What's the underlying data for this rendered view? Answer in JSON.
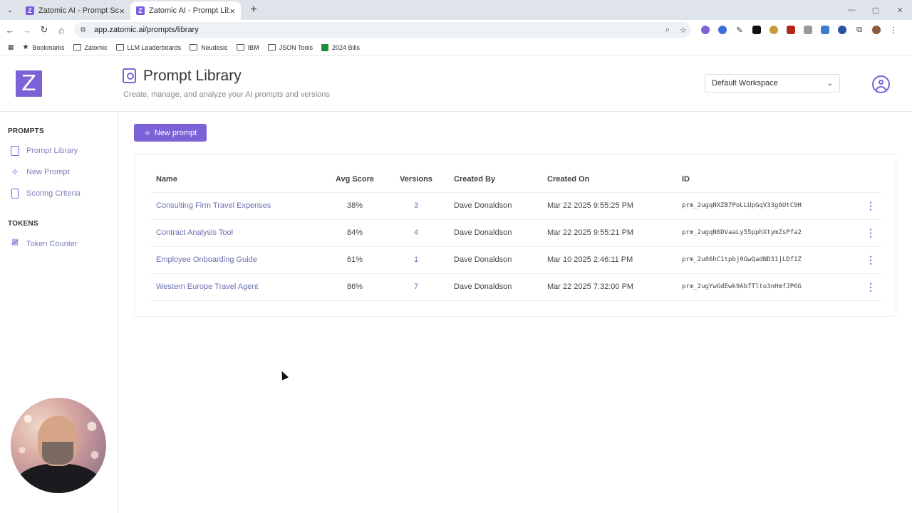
{
  "browser": {
    "tabs": [
      {
        "title": "Zatomic AI - Prompt Scoring",
        "active": false
      },
      {
        "title": "Zatomic AI - Prompt Library",
        "active": true
      }
    ],
    "url": "app.zatomic.ai/prompts/library",
    "bookmarks": [
      "Bookmarks",
      "Zatomic",
      "LLM Leaderboards",
      "Neudesic",
      "IBM",
      "JSON Tools",
      "2024 Bills"
    ]
  },
  "app": {
    "logo_letter": "Z",
    "title": "Prompt Library",
    "subtitle": "Create, manage, and analyze your AI prompts and versions",
    "workspace": "Default Workspace",
    "accent_color": "#7b62d6"
  },
  "sidebar": {
    "prompts_heading": "PROMPTS",
    "prompt_items": [
      {
        "label": "Prompt Library",
        "icon": "library-icon"
      },
      {
        "label": "New Prompt",
        "icon": "sparkle-icon"
      },
      {
        "label": "Scoring Criteria",
        "icon": "clipboard-icon"
      }
    ],
    "tokens_heading": "TOKENS",
    "token_items": [
      {
        "label": "Token Counter",
        "icon": "tally-icon"
      }
    ]
  },
  "main": {
    "new_prompt_label": "New prompt",
    "columns": [
      "Name",
      "Avg Score",
      "Versions",
      "Created By",
      "Created On",
      "ID"
    ],
    "rows": [
      {
        "name": "Consulting Firm Travel Expenses",
        "score": "38%",
        "versions": "3",
        "created_by": "Dave Donaldson",
        "created_on": "Mar 22 2025 9:55:25 PM",
        "id": "prm_2ugqNXZB7PoLLUpGqV33g6UtC9H"
      },
      {
        "name": "Contract Analysis Tool",
        "score": "84%",
        "versions": "4",
        "created_by": "Dave Donaldson",
        "created_on": "Mar 22 2025 9:55:21 PM",
        "id": "prm_2ugqN6DVaaLy55pphXtymZsPfa2"
      },
      {
        "name": "Employee Onboarding Guide",
        "score": "61%",
        "versions": "1",
        "created_by": "Dave Donaldson",
        "created_on": "Mar 10 2025 2:46:11 PM",
        "id": "prm_2u86hC1tpbj0GwQadND31jLDf1Z"
      },
      {
        "name": "Western Europe Travel Agent",
        "score": "86%",
        "versions": "7",
        "created_by": "Dave Donaldson",
        "created_on": "Mar 22 2025 7:32:00 PM",
        "id": "prm_2ugYwGdEwk9Ab7Tlto3nHmfJP6G"
      }
    ]
  }
}
